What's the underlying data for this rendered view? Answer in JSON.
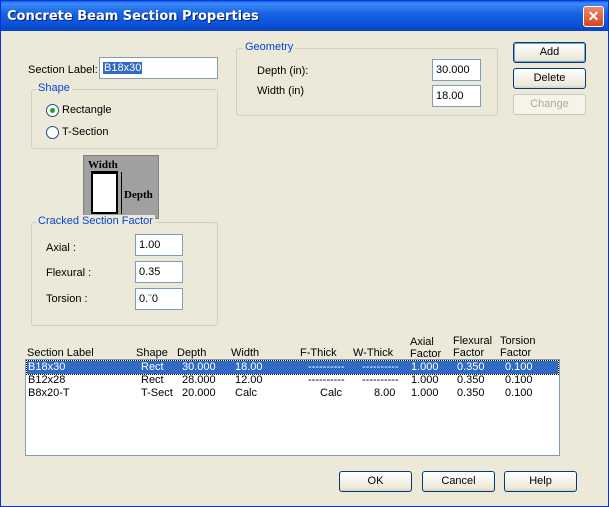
{
  "window": {
    "title": "Concrete Beam Section Properties"
  },
  "section_label": {
    "label": "Section Label:",
    "value": "B18x30"
  },
  "shape": {
    "legend": "Shape",
    "options": [
      {
        "label": "Rectangle",
        "checked": true
      },
      {
        "label": "T-Section",
        "checked": false
      }
    ]
  },
  "diagram": {
    "width_label": "Width",
    "depth_label": "Depth"
  },
  "cracked": {
    "legend": "Cracked Section Factor",
    "axial_label": "Axial :",
    "axial_value": "1.00",
    "flexural_label": "Flexural :",
    "flexural_value": "0.35",
    "torsion_label": "Torsion :",
    "torsion_value": "0.¨0"
  },
  "geometry": {
    "legend": "Geometry",
    "depth_label": "Depth (in):",
    "depth_value": "30.000",
    "width_label": "Width (in)",
    "width_value": "18.00"
  },
  "buttons": {
    "add": "Add",
    "delete": "Delete",
    "change": "Change",
    "ok": "OK",
    "cancel": "Cancel",
    "help": "Help"
  },
  "table": {
    "headers": {
      "section_label": "Section Label",
      "shape": "Shape",
      "depth": "Depth",
      "width": "Width",
      "f_thick": "F-Thick",
      "w_thick": "W-Thick",
      "axial_1": "Axial",
      "axial_2": "Factor",
      "flexural_1": "Flexural",
      "flexural_2": "Factor",
      "torsion_1": "Torsion",
      "torsion_2": "Factor"
    },
    "rows": [
      {
        "label": "B18x30",
        "shape": "Rect",
        "depth": "30.000",
        "width": "18.00",
        "f_thick": "----------",
        "w_thick": "----------",
        "axial": "1.000",
        "flexural": "0.350",
        "torsion": "0.100"
      },
      {
        "label": "B12x28",
        "shape": "Rect",
        "depth": "28.000",
        "width": "12.00",
        "f_thick": "----------",
        "w_thick": "----------",
        "axial": "1.000",
        "flexural": "0.350",
        "torsion": "0.100"
      },
      {
        "label": "B8x20-T",
        "shape": "T-Sect",
        "depth": "20.000",
        "width": "Calc",
        "f_thick": "Calc",
        "w_thick": "8.00",
        "axial": "1.000",
        "flexural": "0.350",
        "torsion": "0.100"
      }
    ]
  }
}
